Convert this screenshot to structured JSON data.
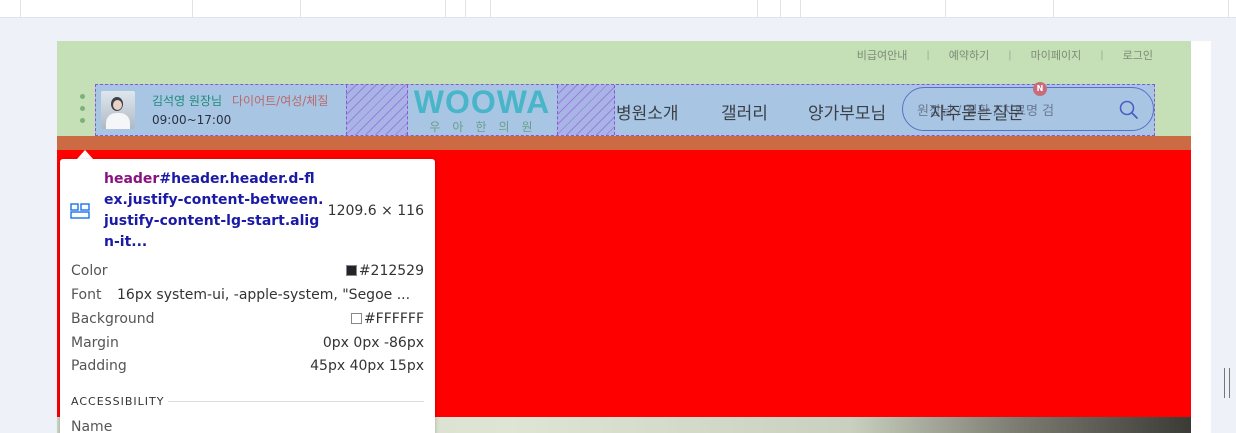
{
  "colors": {
    "header_content": "#a8c6e4",
    "header_padding": "#c5dfb7",
    "header_margin": "#cc6a44",
    "hero": "#ff0000",
    "selection_outline": "#8a55d6",
    "doctor_name": "#1f8a7a",
    "specialty": "#b86a6a",
    "logo": "#49b5c8",
    "selector_tag": "#881280",
    "selector_class": "#1a1aa6"
  },
  "util_nav": [
    "비급여안내",
    "예약하기",
    "마이페이지",
    "로그인"
  ],
  "doctor": {
    "name": "김석영 원장님",
    "specialty": "다이어트/여성/체질",
    "hours": "09:00~17:00"
  },
  "logo": {
    "word": "WOOWA",
    "sub": "우아한의원"
  },
  "gnb": [
    "병원소개",
    "갤러리",
    "양가부모님",
    "자주묻는질문"
  ],
  "search": {
    "placeholder": "원장님 / 질환 / 치료명 검",
    "icon": "search-icon"
  },
  "badge": "N",
  "inspector": {
    "tag": "header",
    "selector": "#header.header.d-flex.justify-content-between.justify-content-lg-start.align-it...",
    "size": "1209.6 × 116",
    "rows": [
      {
        "key": "Color",
        "value": "#212529",
        "swatch": "#212529"
      },
      {
        "key": "Font",
        "value": "16px system-ui, -apple-system, \"Segoe ..."
      },
      {
        "key": "Background",
        "value": "#FFFFFF",
        "swatch": "#FFFFFF"
      },
      {
        "key": "Margin",
        "value": "0px 0px -86px"
      },
      {
        "key": "Padding",
        "value": "45px 40px 15px"
      }
    ],
    "section": "ACCESSIBILITY",
    "name_label": "Name",
    "icon": "element-layout-icon"
  }
}
